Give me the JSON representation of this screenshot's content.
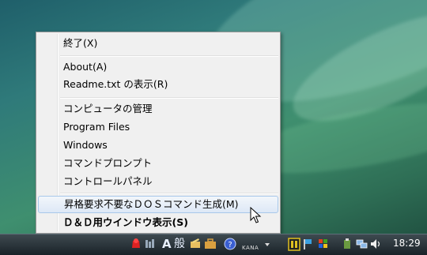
{
  "menu": {
    "items": [
      {
        "label": "終了(X)"
      },
      {
        "label": "About(A)"
      },
      {
        "label": "Readme.txt の表示(R)"
      },
      {
        "label": "コンピュータの管理"
      },
      {
        "label": "Program Files"
      },
      {
        "label": "Windows"
      },
      {
        "label": "コマンドプロンプト"
      },
      {
        "label": "コントロールパネル"
      },
      {
        "label": "昇格要求不要なＤＯＳコマンド生成(M)"
      },
      {
        "label": "Ｄ＆Ｄ用ウインドウ表示(S)"
      }
    ]
  },
  "taskbar": {
    "ime_mode": "A",
    "ime_input": "般",
    "ime_kana": "KANA",
    "clock": "18:29"
  },
  "colors": {
    "menu_bg": "#f0f0f0",
    "hover_border": "#a8c8ea",
    "taskbar": "#1a2228"
  }
}
